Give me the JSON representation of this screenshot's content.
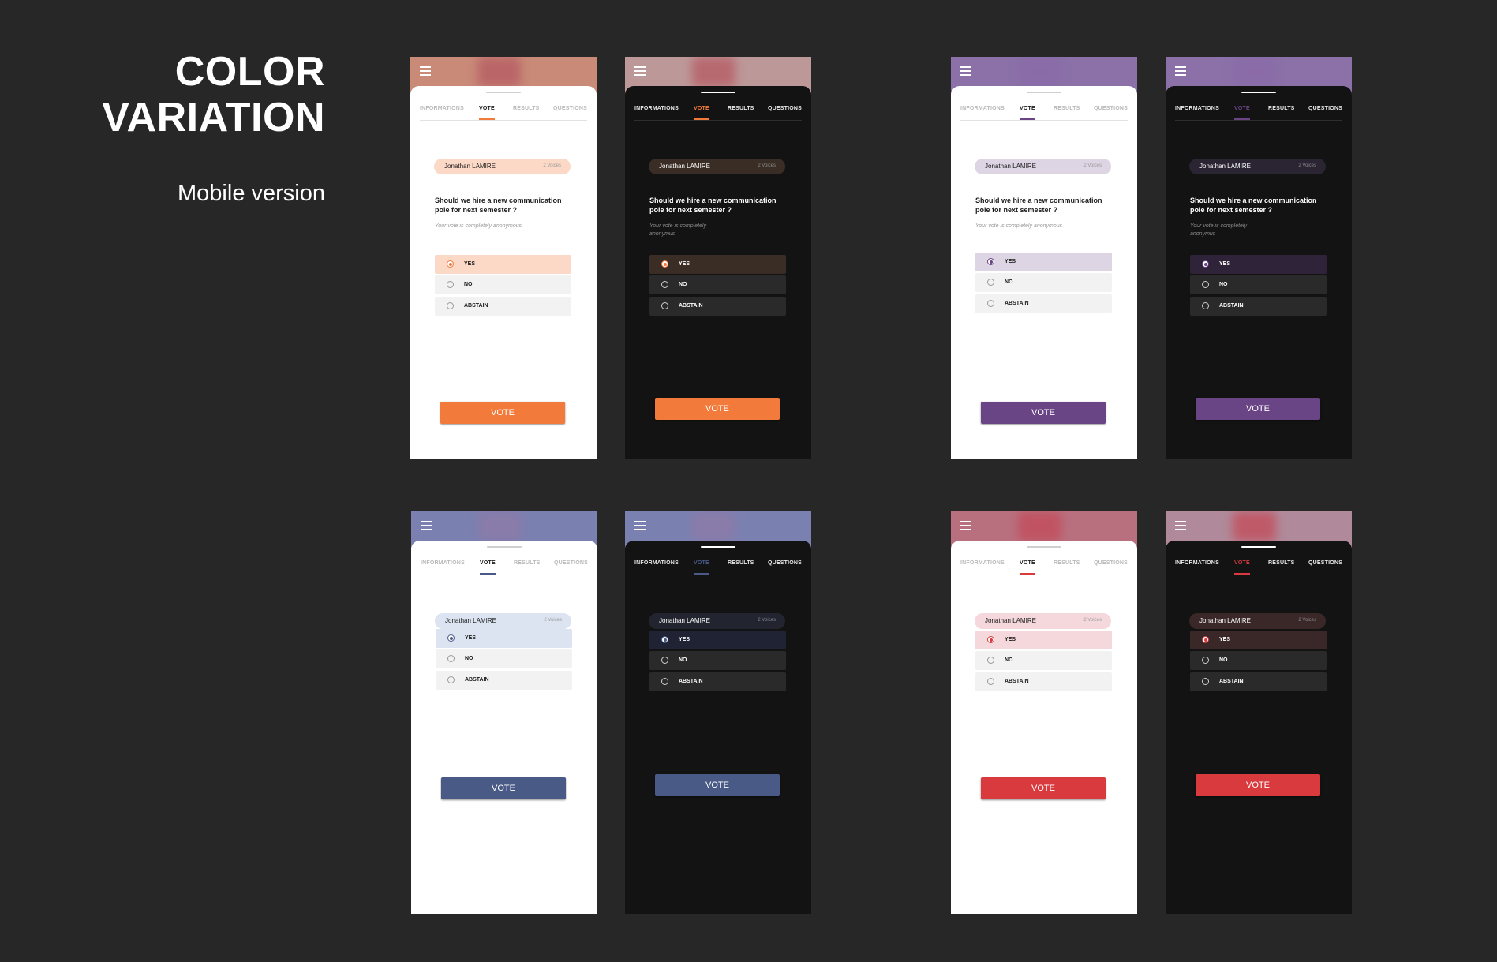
{
  "page": {
    "title": "COLOR\nVARIATION",
    "subtitle": "Mobile version"
  },
  "screens": [
    {
      "theme": "light",
      "accent": "#f27a3a",
      "header_color": "#c98a78",
      "blur_color": "#b55a63",
      "pill_bg": "#fcd8c6",
      "selected_bg": "#fcd8c6",
      "tabs": [
        {
          "label": "INFORMATIONS"
        },
        {
          "label": "VOTE"
        },
        {
          "label": "RESULTS"
        },
        {
          "label": "QUESTIONS"
        }
      ],
      "candidate": {
        "name": "Jonathan LAMIRE",
        "count": "2 Voices"
      },
      "question": "Should we hire a new communication pole for next semester ?",
      "note": "Your vote is completely anonymous",
      "options": [
        {
          "label": "YES"
        },
        {
          "label": "NO"
        },
        {
          "label": "ABSTAIN"
        }
      ],
      "vote_label": "VOTE"
    },
    {
      "theme": "dark",
      "accent": "#f27a3a",
      "header_color": "#bd9898",
      "blur_color": "#b55a63",
      "pill_bg": "#3a2d26",
      "selected_bg": "#3a2d26",
      "tabs": [
        {
          "label": "INFORMATIONS"
        },
        {
          "label": "VOTE"
        },
        {
          "label": "RESULTS"
        },
        {
          "label": "QUESTIONS"
        }
      ],
      "candidate": {
        "name": "Jonathan LAMIRE",
        "count": "2 Voices"
      },
      "question": "Should we hire a new communication pole for next semester ?",
      "note": "Your vote is completely\nanonymus",
      "options": [
        {
          "label": "YES"
        },
        {
          "label": "NO"
        },
        {
          "label": "ABSTAIN"
        }
      ],
      "vote_label": "VOTE"
    },
    {
      "theme": "light",
      "accent": "#6a4585",
      "header_color": "#8b71a8",
      "blur_color": "#8a6aa8",
      "pill_bg": "#ddd5e3",
      "selected_bg": "#ddd5e3",
      "tabs": [
        {
          "label": "INFORMATIONS"
        },
        {
          "label": "VOTE"
        },
        {
          "label": "RESULTS"
        },
        {
          "label": "QUESTIONS"
        }
      ],
      "candidate": {
        "name": "Jonathan LAMIRE",
        "count": "2 Voices"
      },
      "question": "Should we hire a new communication pole for next semester ?",
      "note": "Your vote is completely anonymous",
      "options": [
        {
          "label": "YES"
        },
        {
          "label": "NO"
        },
        {
          "label": "ABSTAIN"
        }
      ],
      "vote_label": "VOTE"
    },
    {
      "theme": "dark",
      "accent": "#6a4585",
      "header_color": "#8b71a8",
      "blur_color": "#8a6aa8",
      "pill_bg": "#2a2433",
      "selected_bg": "#2f2339",
      "tabs": [
        {
          "label": "INFORMATIONS"
        },
        {
          "label": "VOTE"
        },
        {
          "label": "RESULTS"
        },
        {
          "label": "QUESTIONS"
        }
      ],
      "candidate": {
        "name": "Jonathan LAMIRE",
        "count": "2 Voices"
      },
      "question": "Should we hire a new communication pole for next semester ?",
      "note": "Your vote is completely\nanonymus",
      "options": [
        {
          "label": "YES"
        },
        {
          "label": "NO"
        },
        {
          "label": "ABSTAIN"
        }
      ],
      "vote_label": "VOTE"
    },
    {
      "theme": "light",
      "accent": "#495a86",
      "header_color": "#7a80b0",
      "blur_color": "#8f7aa8",
      "pill_bg": "#dbe4f0",
      "selected_bg": "#dbe4f0",
      "tabs": [
        {
          "label": "INFORMATIONS"
        },
        {
          "label": "VOTE"
        },
        {
          "label": "RESULTS"
        },
        {
          "label": "QUESTIONS"
        }
      ],
      "candidate": {
        "name": "Jonathan LAMIRE",
        "count": "2 Voices"
      },
      "question": "Should we hire a new communication pole for next semester ?",
      "note": "Your vote is completely anonymous",
      "options": [
        {
          "label": "YES"
        },
        {
          "label": "NO"
        },
        {
          "label": "ABSTAIN"
        }
      ],
      "vote_label": "VOTE"
    },
    {
      "theme": "dark",
      "accent": "#495a86",
      "header_color": "#7a80b0",
      "blur_color": "#8f7aa8",
      "pill_bg": "#22242f",
      "selected_bg": "#1f2333",
      "tabs": [
        {
          "label": "INFORMATIONS"
        },
        {
          "label": "VOTE"
        },
        {
          "label": "RESULTS"
        },
        {
          "label": "QUESTIONS"
        }
      ],
      "candidate": {
        "name": "Jonathan LAMIRE",
        "count": "2 Voices"
      },
      "question": "Should we hire a new communication pole for next semester ?",
      "note": "Your vote is completely\nanonymus",
      "options": [
        {
          "label": "YES"
        },
        {
          "label": "NO"
        },
        {
          "label": "ABSTAIN"
        }
      ],
      "vote_label": "VOTE"
    },
    {
      "theme": "light",
      "accent": "#d83a3e",
      "header_color": "#b8707f",
      "blur_color": "#c44a58",
      "pill_bg": "#f5d8dc",
      "selected_bg": "#f5d8dc",
      "tabs": [
        {
          "label": "INFORMATIONS"
        },
        {
          "label": "VOTE"
        },
        {
          "label": "RESULTS"
        },
        {
          "label": "QUESTIONS"
        }
      ],
      "candidate": {
        "name": "Jonathan LAMIRE",
        "count": "2 Voices"
      },
      "question": "Should we hire a new communication pole for next semester ?",
      "note": "Your vote is completely anonymous",
      "options": [
        {
          "label": "YES"
        },
        {
          "label": "NO"
        },
        {
          "label": "ABSTAIN"
        }
      ],
      "vote_label": "VOTE"
    },
    {
      "theme": "dark",
      "accent": "#d83a3e",
      "header_color": "#b08a9a",
      "blur_color": "#c44a58",
      "pill_bg": "#3a2828",
      "selected_bg": "#3a2828",
      "tabs": [
        {
          "label": "INFORMATIONS"
        },
        {
          "label": "VOTE"
        },
        {
          "label": "RESULTS"
        },
        {
          "label": "QUESTIONS"
        }
      ],
      "candidate": {
        "name": "Jonathan LAMIRE",
        "count": "2 Voices"
      },
      "question": "Should we hire a new communication pole for next semester ?",
      "note": "Your vote is completely\nanonymus",
      "options": [
        {
          "label": "YES"
        },
        {
          "label": "NO"
        },
        {
          "label": "ABSTAIN"
        }
      ],
      "vote_label": "VOTE"
    }
  ]
}
